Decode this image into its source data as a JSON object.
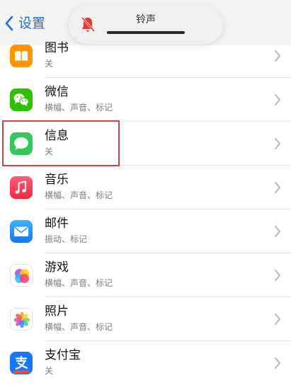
{
  "nav": {
    "back_label": "设置"
  },
  "volume_hud": {
    "title": "铃声",
    "icon": "bell-slash-icon",
    "level": 0.55
  },
  "list": [
    {
      "name": "books",
      "title": "图书",
      "subtitle": "关",
      "icon": "books-app-icon"
    },
    {
      "name": "wechat",
      "title": "微信",
      "subtitle": "横幅、声音、标记",
      "icon": "wechat-app-icon"
    },
    {
      "name": "messages",
      "title": "信息",
      "subtitle": "关",
      "icon": "messages-app-icon",
      "highlighted": true
    },
    {
      "name": "music",
      "title": "音乐",
      "subtitle": "横幅、声音、标记",
      "icon": "music-app-icon"
    },
    {
      "name": "mail",
      "title": "邮件",
      "subtitle": "振动、标记",
      "icon": "mail-app-icon"
    },
    {
      "name": "game-center",
      "title": "游戏",
      "subtitle": "横幅、声音、标记",
      "icon": "game-center-app-icon"
    },
    {
      "name": "photos",
      "title": "照片",
      "subtitle": "横幅、声音、标记",
      "icon": "photos-app-icon"
    },
    {
      "name": "alipay",
      "title": "支付宝",
      "subtitle": "关",
      "icon": "alipay-app-icon"
    }
  ],
  "colors": {
    "accent": "#1f6fdc",
    "highlight_border": "#d04444",
    "books": "#ff9500",
    "wechat": "#2dc100",
    "messages": "#34c759",
    "music": "#fa3c55",
    "mail": "#1a8cff",
    "alipay": "#1677ff"
  }
}
